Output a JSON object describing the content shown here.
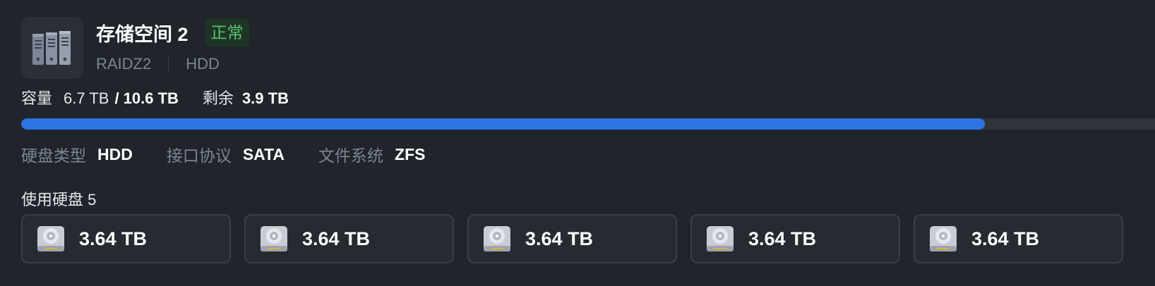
{
  "pool": {
    "title": "存储空间 2",
    "status": "正常",
    "raid": "RAIDZ2",
    "media": "HDD",
    "icon": "server-stack-icon"
  },
  "capacity": {
    "label": "容量",
    "used": "6.7 TB",
    "total": "/ 10.6 TB",
    "free_label": "剩余",
    "free": "3.9 TB",
    "used_fraction": 0.85
  },
  "specs": [
    {
      "label": "硬盘类型",
      "value": "HDD"
    },
    {
      "label": "接口协议",
      "value": "SATA"
    },
    {
      "label": "文件系统",
      "value": "ZFS"
    }
  ],
  "disks": {
    "heading": "使用硬盘 5",
    "items": [
      {
        "size": "3.64 TB",
        "icon": "hard-disk-icon"
      },
      {
        "size": "3.64 TB",
        "icon": "hard-disk-icon"
      },
      {
        "size": "3.64 TB",
        "icon": "hard-disk-icon"
      },
      {
        "size": "3.64 TB",
        "icon": "hard-disk-icon"
      },
      {
        "size": "3.64 TB",
        "icon": "hard-disk-icon"
      }
    ]
  },
  "colors": {
    "background": "#20242b",
    "accent": "#2d74e0",
    "status_ok": "#57c26a"
  }
}
